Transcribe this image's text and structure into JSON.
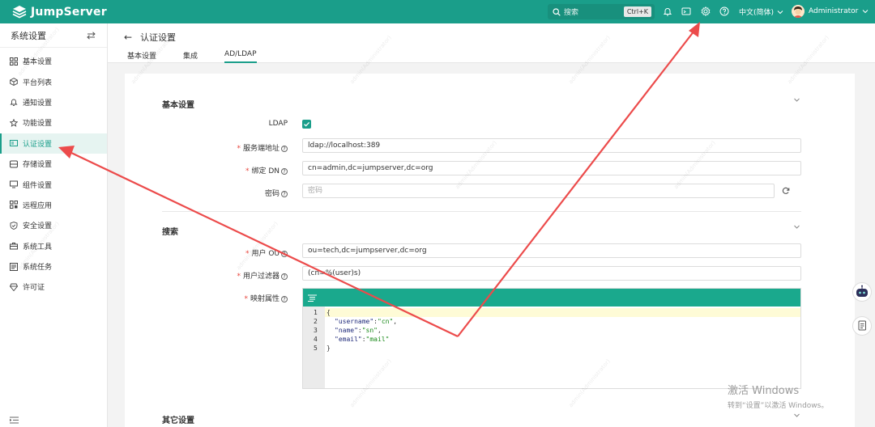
{
  "app": {
    "brand": "JumpServer"
  },
  "topbar": {
    "search_placeholder": "搜索",
    "search_shortcut": "Ctrl+K",
    "language": "中文(简体)",
    "username": "Administrator"
  },
  "sidebar": {
    "title": "系统设置",
    "items": [
      {
        "label": "基本设置",
        "icon": "grid-icon"
      },
      {
        "label": "平台列表",
        "icon": "cube-icon"
      },
      {
        "label": "通知设置",
        "icon": "bell-icon"
      },
      {
        "label": "功能设置",
        "icon": "star-icon"
      },
      {
        "label": "认证设置",
        "icon": "id-card-icon",
        "active": true
      },
      {
        "label": "存储设置",
        "icon": "storage-icon"
      },
      {
        "label": "组件设置",
        "icon": "monitor-icon"
      },
      {
        "label": "远程应用",
        "icon": "apps-icon"
      },
      {
        "label": "安全设置",
        "icon": "shield-icon"
      },
      {
        "label": "系统工具",
        "icon": "toolbox-icon"
      },
      {
        "label": "系统任务",
        "icon": "tasks-icon"
      },
      {
        "label": "许可证",
        "icon": "license-icon"
      }
    ]
  },
  "page": {
    "title": "认证设置",
    "tabs": [
      {
        "label": "基本设置"
      },
      {
        "label": "集成"
      },
      {
        "label": "AD/LDAP",
        "active": true
      }
    ]
  },
  "form": {
    "basic": {
      "title": "基本设置",
      "ldap_label": "LDAP",
      "ldap_enabled": true,
      "server_label": "服务端地址",
      "server_value": "ldap://localhost:389",
      "bind_dn_label": "绑定 DN",
      "bind_dn_value": "cn=admin,dc=jumpserver,dc=org",
      "password_label": "密码",
      "password_placeholder": "密码"
    },
    "search": {
      "title": "搜索",
      "user_ou_label": "用户 OU",
      "user_ou_value": "ou=tech,dc=jumpserver,dc=org",
      "user_filter_label": "用户过滤器",
      "user_filter_value": "(cn=%(user)s)",
      "mapping_label": "映射属性",
      "mapping_lines": [
        {
          "num": "1",
          "text": "{"
        },
        {
          "num": "2",
          "key": "\"username\"",
          "sep": ": ",
          "val": "\"cn\"",
          "tail": ","
        },
        {
          "num": "3",
          "key": "\"name\"",
          "sep": ": ",
          "val": "\"sn\"",
          "tail": ","
        },
        {
          "num": "4",
          "key": "\"email\"",
          "sep": ": ",
          "val": "\"mail\"",
          "tail": ""
        },
        {
          "num": "5",
          "text": "}"
        }
      ]
    },
    "other": {
      "title": "其它设置"
    }
  },
  "overlay": {
    "watermark": "admin(Administrator)",
    "activate_line1": "激活 Windows",
    "activate_line2": "转到“设置”以激活 Windows。"
  },
  "colors": {
    "brand": "#1a9e8a",
    "annotation_arrow": "#ec4b4b"
  }
}
